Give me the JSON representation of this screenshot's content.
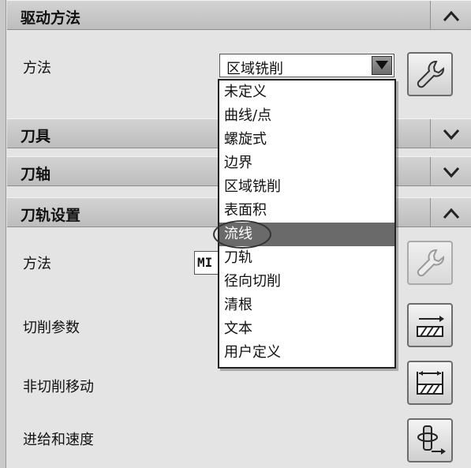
{
  "sections": {
    "drive_method": {
      "title": "驱动方法",
      "toggle_icon": "chevron-up-icon"
    },
    "tool": {
      "title": "刀具",
      "toggle_icon": "chevron-down-icon"
    },
    "axis": {
      "title": "刀轴",
      "toggle_icon": "chevron-down-icon"
    },
    "toolpath_settings": {
      "title": "刀轨设置",
      "toggle_icon": "chevron-up-icon"
    }
  },
  "drive": {
    "method_label": "方法",
    "method_value": "区域铣削",
    "edit_icon": "wrench-icon"
  },
  "dropdown": {
    "options": [
      "未定义",
      "曲线/点",
      "螺旋式",
      "边界",
      "区域铣削",
      "表面积",
      "流线",
      "刀轨",
      "径向切削",
      "清根",
      "文本",
      "用户定义"
    ],
    "selected_index": 6,
    "selected_label": "流线"
  },
  "toolpath": {
    "method_label": "方法",
    "method_value": "MI",
    "cut_params_label": "切削参数",
    "non_cut_label": "非切削移动",
    "feeds_label": "进给和速度",
    "wrench_icon": "wrench-icon",
    "cut_params_icon": "cut-parameters-icon",
    "non_cut_icon": "non-cutting-moves-icon",
    "feeds_icon": "feeds-speeds-icon"
  },
  "colors": {
    "header_bg": "#c4c4c4",
    "panel_bg": "#e4e4e4",
    "selected_bg": "#6a6a6a"
  }
}
